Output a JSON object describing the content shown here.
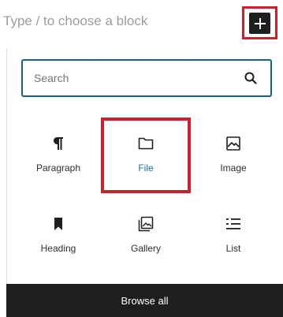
{
  "editor": {
    "placeholder": "Type / to choose a block"
  },
  "toolbar": {
    "add_block_icon": "plus-icon"
  },
  "inserter": {
    "search": {
      "placeholder": "Search",
      "value": ""
    },
    "blocks": [
      {
        "label": "Paragraph",
        "icon": "paragraph-icon",
        "selected": false
      },
      {
        "label": "File",
        "icon": "folder-icon",
        "selected": true
      },
      {
        "label": "Image",
        "icon": "image-icon",
        "selected": false
      },
      {
        "label": "Heading",
        "icon": "bookmark-icon",
        "selected": false
      },
      {
        "label": "Gallery",
        "icon": "gallery-icon",
        "selected": false
      },
      {
        "label": "List",
        "icon": "list-icon",
        "selected": false
      }
    ],
    "browse_all_label": "Browse all"
  },
  "colors": {
    "highlight": "#cc1f2b",
    "accent": "#1f6fa2",
    "search_border": "#1b5f84",
    "dark": "#1e1e1e"
  }
}
